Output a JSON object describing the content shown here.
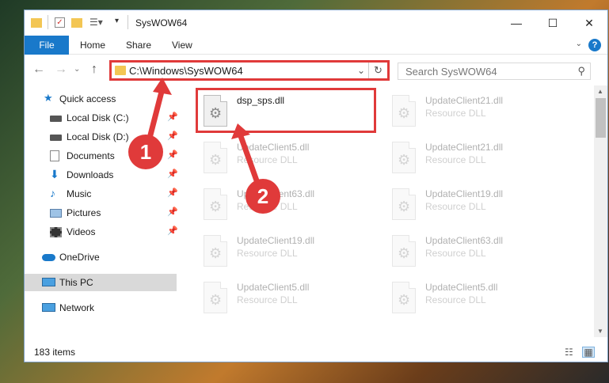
{
  "window": {
    "title": "SysWOW64"
  },
  "ribbon": {
    "tabs": [
      "File",
      "Home",
      "Share",
      "View"
    ],
    "help": "?"
  },
  "address": {
    "path": "C:\\Windows\\SysWOW64"
  },
  "search": {
    "placeholder": "Search SysWOW64"
  },
  "sidebar": {
    "items": [
      {
        "label": "Quick access",
        "icon": "star-icon"
      },
      {
        "label": "Local Disk (C:)",
        "icon": "drive-icon"
      },
      {
        "label": "Local Disk (D:)",
        "icon": "drive-icon"
      },
      {
        "label": "Documents",
        "icon": "documents-icon"
      },
      {
        "label": "Downloads",
        "icon": "download-icon"
      },
      {
        "label": "Music",
        "icon": "music-icon"
      },
      {
        "label": "Pictures",
        "icon": "pictures-icon"
      },
      {
        "label": "Videos",
        "icon": "videos-icon"
      },
      {
        "label": "OneDrive",
        "icon": "cloud-icon"
      },
      {
        "label": "This PC",
        "icon": "pc-icon"
      },
      {
        "label": "Network",
        "icon": "network-icon"
      }
    ]
  },
  "files": [
    {
      "name": "dsp_sps.dll",
      "type": ""
    },
    {
      "name": "UpdateClient21.dll",
      "type": "Resource DLL"
    },
    {
      "name": "UpdateClient5.dll",
      "type": "Resource DLL"
    },
    {
      "name": "UpdateClient21.dll",
      "type": "Resource DLL"
    },
    {
      "name": "UpdateClient63.dll",
      "type": "Resource DLL"
    },
    {
      "name": "UpdateClient19.dll",
      "type": "Resource DLL"
    },
    {
      "name": "UpdateClient19.dll",
      "type": "Resource DLL"
    },
    {
      "name": "UpdateClient63.dll",
      "type": "Resource DLL"
    },
    {
      "name": "UpdateClient5.dll",
      "type": "Resource DLL"
    },
    {
      "name": "UpdateClient5.dll",
      "type": "Resource DLL"
    }
  ],
  "status": {
    "count": "183 items"
  },
  "annotations": {
    "badge1": "1",
    "badge2": "2"
  },
  "colors": {
    "accent": "#1979ca",
    "annotation": "#e03a3a"
  }
}
